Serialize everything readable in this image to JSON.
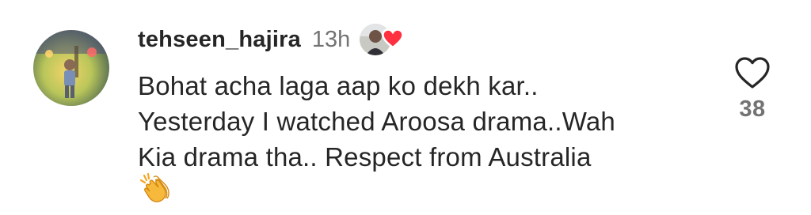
{
  "comment": {
    "username": "tehseen_hajira",
    "timestamp": "13h",
    "text_lines": [
      "Bohat acha laga aap ko dekh kar..",
      "Yesterday I watched Aroosa drama..Wah",
      "Kia drama tha.. Respect from Australia"
    ],
    "emoji": "clapping-hands-emoji",
    "liked_by_author": true,
    "like_count": "38"
  },
  "icons": {
    "like": "heart-outline-icon",
    "author_like": "red-heart-icon"
  },
  "colors": {
    "text": "#262626",
    "secondary_text": "#737373",
    "heart_outline": "#262626",
    "author_heart": "#ff3040",
    "clap_emoji": "#f6b93b"
  }
}
